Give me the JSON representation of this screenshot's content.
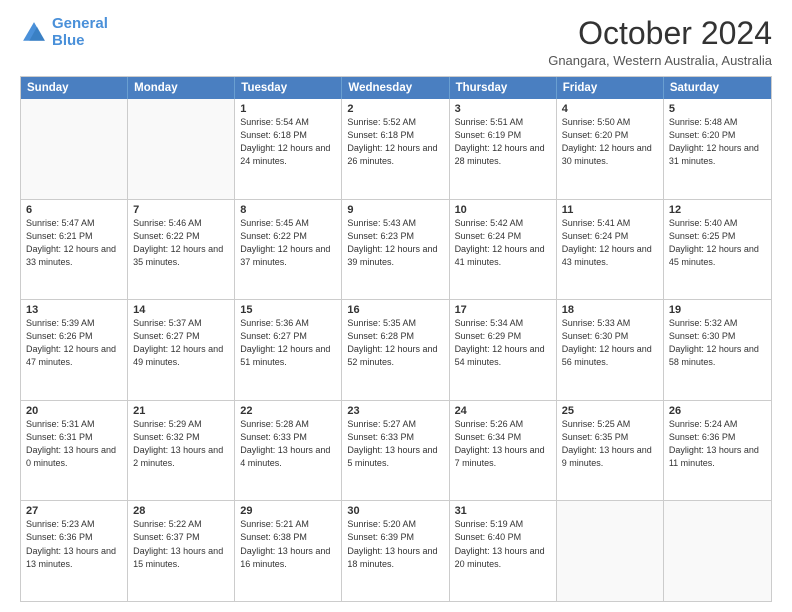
{
  "logo": {
    "line1": "General",
    "line2": "Blue"
  },
  "header": {
    "title": "October 2024",
    "subtitle": "Gnangara, Western Australia, Australia"
  },
  "days_of_week": [
    "Sunday",
    "Monday",
    "Tuesday",
    "Wednesday",
    "Thursday",
    "Friday",
    "Saturday"
  ],
  "weeks": [
    [
      {
        "day": "",
        "info": ""
      },
      {
        "day": "",
        "info": ""
      },
      {
        "day": "1",
        "info": "Sunrise: 5:54 AM\nSunset: 6:18 PM\nDaylight: 12 hours and 24 minutes."
      },
      {
        "day": "2",
        "info": "Sunrise: 5:52 AM\nSunset: 6:18 PM\nDaylight: 12 hours and 26 minutes."
      },
      {
        "day": "3",
        "info": "Sunrise: 5:51 AM\nSunset: 6:19 PM\nDaylight: 12 hours and 28 minutes."
      },
      {
        "day": "4",
        "info": "Sunrise: 5:50 AM\nSunset: 6:20 PM\nDaylight: 12 hours and 30 minutes."
      },
      {
        "day": "5",
        "info": "Sunrise: 5:48 AM\nSunset: 6:20 PM\nDaylight: 12 hours and 31 minutes."
      }
    ],
    [
      {
        "day": "6",
        "info": "Sunrise: 5:47 AM\nSunset: 6:21 PM\nDaylight: 12 hours and 33 minutes."
      },
      {
        "day": "7",
        "info": "Sunrise: 5:46 AM\nSunset: 6:22 PM\nDaylight: 12 hours and 35 minutes."
      },
      {
        "day": "8",
        "info": "Sunrise: 5:45 AM\nSunset: 6:22 PM\nDaylight: 12 hours and 37 minutes."
      },
      {
        "day": "9",
        "info": "Sunrise: 5:43 AM\nSunset: 6:23 PM\nDaylight: 12 hours and 39 minutes."
      },
      {
        "day": "10",
        "info": "Sunrise: 5:42 AM\nSunset: 6:24 PM\nDaylight: 12 hours and 41 minutes."
      },
      {
        "day": "11",
        "info": "Sunrise: 5:41 AM\nSunset: 6:24 PM\nDaylight: 12 hours and 43 minutes."
      },
      {
        "day": "12",
        "info": "Sunrise: 5:40 AM\nSunset: 6:25 PM\nDaylight: 12 hours and 45 minutes."
      }
    ],
    [
      {
        "day": "13",
        "info": "Sunrise: 5:39 AM\nSunset: 6:26 PM\nDaylight: 12 hours and 47 minutes."
      },
      {
        "day": "14",
        "info": "Sunrise: 5:37 AM\nSunset: 6:27 PM\nDaylight: 12 hours and 49 minutes."
      },
      {
        "day": "15",
        "info": "Sunrise: 5:36 AM\nSunset: 6:27 PM\nDaylight: 12 hours and 51 minutes."
      },
      {
        "day": "16",
        "info": "Sunrise: 5:35 AM\nSunset: 6:28 PM\nDaylight: 12 hours and 52 minutes."
      },
      {
        "day": "17",
        "info": "Sunrise: 5:34 AM\nSunset: 6:29 PM\nDaylight: 12 hours and 54 minutes."
      },
      {
        "day": "18",
        "info": "Sunrise: 5:33 AM\nSunset: 6:30 PM\nDaylight: 12 hours and 56 minutes."
      },
      {
        "day": "19",
        "info": "Sunrise: 5:32 AM\nSunset: 6:30 PM\nDaylight: 12 hours and 58 minutes."
      }
    ],
    [
      {
        "day": "20",
        "info": "Sunrise: 5:31 AM\nSunset: 6:31 PM\nDaylight: 13 hours and 0 minutes."
      },
      {
        "day": "21",
        "info": "Sunrise: 5:29 AM\nSunset: 6:32 PM\nDaylight: 13 hours and 2 minutes."
      },
      {
        "day": "22",
        "info": "Sunrise: 5:28 AM\nSunset: 6:33 PM\nDaylight: 13 hours and 4 minutes."
      },
      {
        "day": "23",
        "info": "Sunrise: 5:27 AM\nSunset: 6:33 PM\nDaylight: 13 hours and 5 minutes."
      },
      {
        "day": "24",
        "info": "Sunrise: 5:26 AM\nSunset: 6:34 PM\nDaylight: 13 hours and 7 minutes."
      },
      {
        "day": "25",
        "info": "Sunrise: 5:25 AM\nSunset: 6:35 PM\nDaylight: 13 hours and 9 minutes."
      },
      {
        "day": "26",
        "info": "Sunrise: 5:24 AM\nSunset: 6:36 PM\nDaylight: 13 hours and 11 minutes."
      }
    ],
    [
      {
        "day": "27",
        "info": "Sunrise: 5:23 AM\nSunset: 6:36 PM\nDaylight: 13 hours and 13 minutes."
      },
      {
        "day": "28",
        "info": "Sunrise: 5:22 AM\nSunset: 6:37 PM\nDaylight: 13 hours and 15 minutes."
      },
      {
        "day": "29",
        "info": "Sunrise: 5:21 AM\nSunset: 6:38 PM\nDaylight: 13 hours and 16 minutes."
      },
      {
        "day": "30",
        "info": "Sunrise: 5:20 AM\nSunset: 6:39 PM\nDaylight: 13 hours and 18 minutes."
      },
      {
        "day": "31",
        "info": "Sunrise: 5:19 AM\nSunset: 6:40 PM\nDaylight: 13 hours and 20 minutes."
      },
      {
        "day": "",
        "info": ""
      },
      {
        "day": "",
        "info": ""
      }
    ]
  ]
}
